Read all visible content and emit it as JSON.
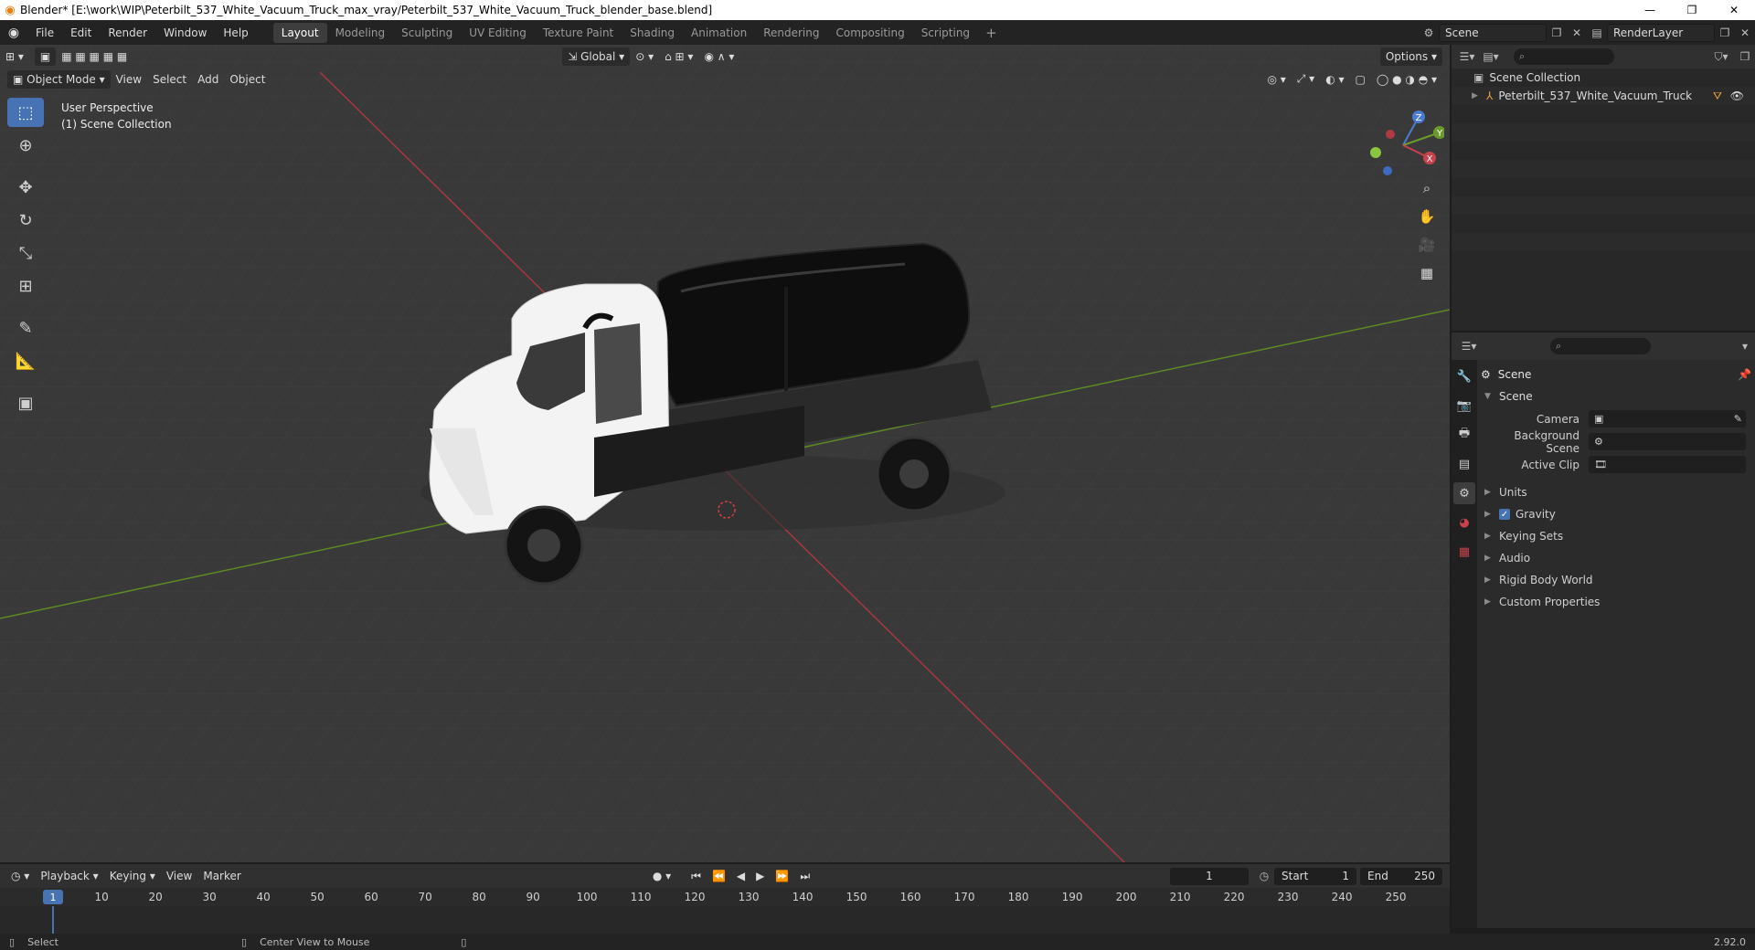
{
  "window": {
    "title": "Blender* [E:\\work\\WIP\\Peterbilt_537_White_Vacuum_Truck_max_vray/Peterbilt_537_White_Vacuum_Truck_blender_base.blend]",
    "minimize": "—",
    "restore": "❐",
    "close": "✕"
  },
  "menu": {
    "items": [
      "File",
      "Edit",
      "Render",
      "Window",
      "Help"
    ]
  },
  "workspaces": {
    "tabs": [
      "Layout",
      "Modeling",
      "Sculpting",
      "UV Editing",
      "Texture Paint",
      "Shading",
      "Animation",
      "Rendering",
      "Compositing",
      "Scripting"
    ],
    "active": "Layout",
    "add": "+"
  },
  "scene_selector": {
    "value": "Scene"
  },
  "view_layer": {
    "value": "RenderLayer"
  },
  "viewport": {
    "mode": "Object Mode",
    "menus": [
      "View",
      "Select",
      "Add",
      "Object"
    ],
    "orientation": "Global",
    "options_label": "Options",
    "overlay_line1": "User Perspective",
    "overlay_line2": "(1) Scene Collection",
    "gizmo": {
      "z": "Z",
      "y": "Y",
      "x": "X"
    }
  },
  "outliner": {
    "root": "Scene Collection",
    "items": [
      "Peterbilt_537_White_Vacuum_Truck"
    ]
  },
  "properties": {
    "context_title": "Scene",
    "section": "Scene",
    "fields": [
      {
        "label": "Camera",
        "value": ""
      },
      {
        "label": "Background Scene",
        "value": ""
      },
      {
        "label": "Active Clip",
        "value": ""
      }
    ],
    "subpanels": [
      "Units",
      "Gravity",
      "Keying Sets",
      "Audio",
      "Rigid Body World",
      "Custom Properties"
    ],
    "gravity_checked": true
  },
  "timeline": {
    "menus": [
      "Playback",
      "Keying",
      "View",
      "Marker"
    ],
    "current_frame": "1",
    "start_label": "Start",
    "start": "1",
    "end_label": "End",
    "end": "250",
    "ticks": [
      "10",
      "20",
      "30",
      "40",
      "50",
      "60",
      "70",
      "80",
      "90",
      "100",
      "110",
      "120",
      "130",
      "140",
      "150",
      "160",
      "170",
      "180",
      "190",
      "200",
      "210",
      "220",
      "230",
      "240",
      "250"
    ],
    "marker_label": "1"
  },
  "statusbar": {
    "left": "Select",
    "middle": "Center View to Mouse",
    "version": "2.92.0"
  },
  "colors": {
    "accent": "#4772b3",
    "x_axis": "#c8414b",
    "y_axis": "#6b9a2c",
    "blender_orange": "#e87d0d"
  }
}
